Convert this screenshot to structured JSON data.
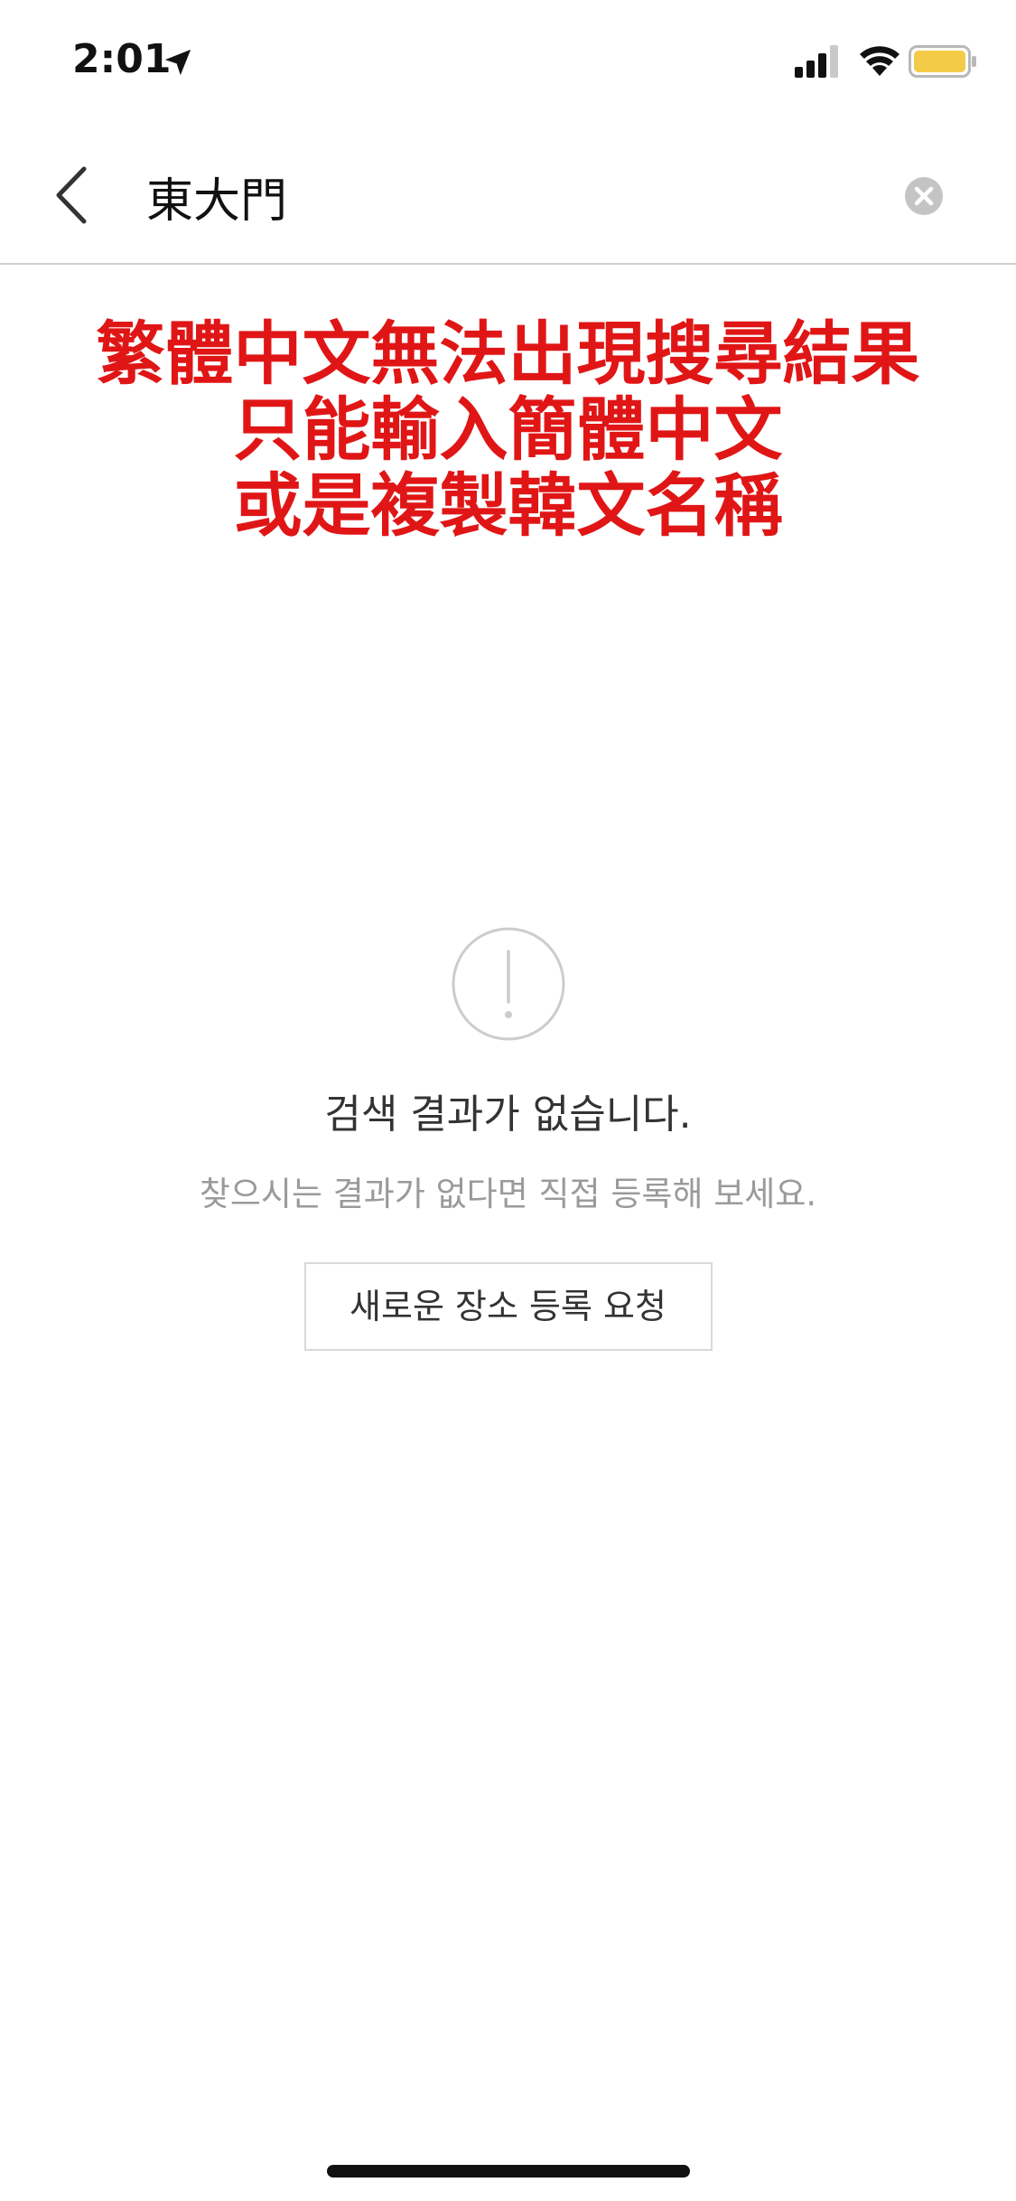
{
  "status_bar": {
    "time": "2:01",
    "location_icon": "location-arrow-icon",
    "signal_icon": "cellular-signal-icon",
    "wifi_icon": "wifi-icon",
    "battery_icon": "battery-icon",
    "battery_color": "#f4cb47"
  },
  "search": {
    "query": "東大門",
    "back_icon": "chevron-left-icon",
    "clear_icon": "clear-circle-icon"
  },
  "annotation": {
    "lines": [
      "繁體中文無法出現搜尋結果",
      "只能輸入簡體中文",
      "或是複製韓文名稱"
    ],
    "color": "#e01616"
  },
  "empty_state": {
    "icon": "exclamation-circle-icon",
    "title": "검색 결과가 없습니다.",
    "subtitle": "찾으시는 결과가 없다면 직접 등록해 보세요.",
    "button_label": "새로운 장소 등록 요청"
  }
}
